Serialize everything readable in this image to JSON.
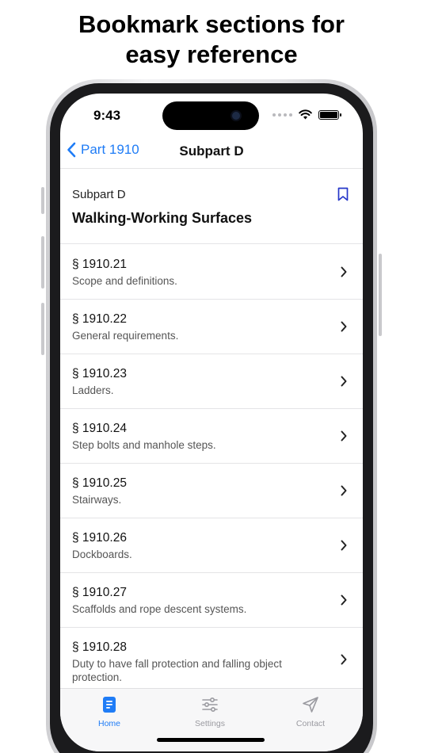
{
  "headline": {
    "line1": "Bookmark sections for",
    "line2": "easy reference"
  },
  "status_bar": {
    "time": "9:43"
  },
  "navbar": {
    "back_label": "Part 1910",
    "title": "Subpart D"
  },
  "header": {
    "subpart": "Subpart D",
    "title": "Walking-Working Surfaces"
  },
  "sections": [
    {
      "number": "§ 1910.21",
      "description": "Scope and definitions."
    },
    {
      "number": "§ 1910.22",
      "description": "General requirements."
    },
    {
      "number": "§ 1910.23",
      "description": "Ladders."
    },
    {
      "number": "§ 1910.24",
      "description": "Step bolts and manhole steps."
    },
    {
      "number": "§ 1910.25",
      "description": "Stairways."
    },
    {
      "number": "§ 1910.26",
      "description": "Dockboards."
    },
    {
      "number": "§ 1910.27",
      "description": "Scaffolds and rope descent systems."
    },
    {
      "number": "§ 1910.28",
      "description": "Duty to have fall protection and falling object protection."
    }
  ],
  "tabs": {
    "home": "Home",
    "settings": "Settings",
    "contact": "Contact"
  },
  "colors": {
    "accent": "#1f7cf6",
    "bookmark": "#2637c9",
    "inactive": "#9a9aa0"
  }
}
